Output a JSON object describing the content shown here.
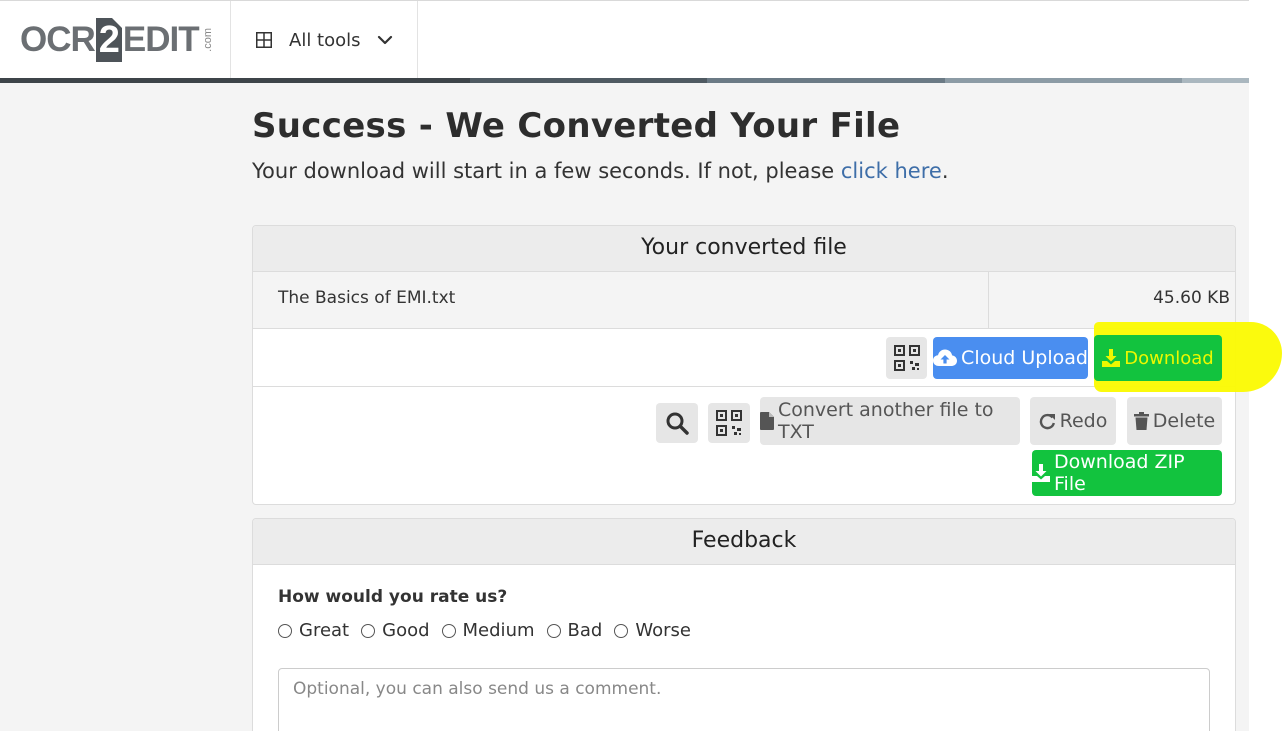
{
  "header": {
    "logo": {
      "ocr": "OCR",
      "two": "2",
      "edit": "EDIT",
      "com": ".com"
    },
    "all_tools_label": "All tools"
  },
  "progress_colors": [
    "#3d4449",
    "#4f5a62",
    "#6b7a85",
    "#8c9ba5",
    "#aab7bf"
  ],
  "main": {
    "title": "Success - We Converted Your File",
    "subtitle_text": "Your download will start in a few seconds. If not, please",
    "subtitle_link": "click here",
    "subtitle_end": "."
  },
  "converted_card": {
    "heading": "Your converted file",
    "file_name": "The Basics of EMI.txt",
    "file_size": "45.60 KB",
    "cloud_upload_label": "Cloud Upload",
    "download_label": "Download",
    "convert_another_label": "Convert another file to TXT",
    "redo_label": "Redo",
    "delete_label": "Delete",
    "download_zip_label": "Download ZIP File"
  },
  "feedback": {
    "heading": "Feedback",
    "question": "How would you rate us?",
    "options": [
      "Great",
      "Good",
      "Medium",
      "Bad",
      "Worse"
    ],
    "comment_placeholder": "Optional, you can also send us a comment."
  }
}
